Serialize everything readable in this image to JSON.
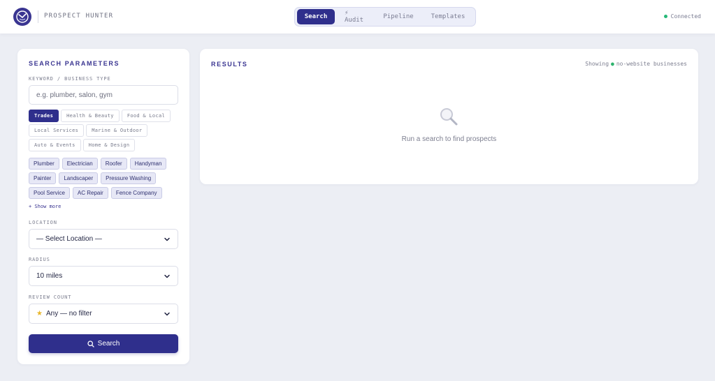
{
  "header": {
    "brand": "PROSPECT HUNTER",
    "tabs": [
      {
        "label": "Search",
        "active": true
      },
      {
        "label": "⚡ Audit",
        "active": false
      },
      {
        "label": "Pipeline",
        "active": false
      },
      {
        "label": "Templates",
        "active": false
      }
    ],
    "status": "Connected",
    "status_color": "#25b877"
  },
  "search": {
    "title": "SEARCH PARAMETERS",
    "keyword_label": "KEYWORD / BUSINESS TYPE",
    "keyword_placeholder": "e.g. plumber, salon, gym",
    "categories": [
      {
        "label": "Trades",
        "active": true
      },
      {
        "label": "Health & Beauty",
        "active": false
      },
      {
        "label": "Food & Local",
        "active": false
      },
      {
        "label": "Local Services",
        "active": false
      },
      {
        "label": "Marine & Outdoor",
        "active": false
      },
      {
        "label": "Auto & Events",
        "active": false
      },
      {
        "label": "Home & Design",
        "active": false
      }
    ],
    "subcategories": [
      "Plumber",
      "Electrician",
      "Roofer",
      "Handyman",
      "Painter",
      "Landscaper",
      "Pressure Washing",
      "Pool Service",
      "AC Repair",
      "Fence Company"
    ],
    "show_more": "+ Show more",
    "location_label": "LOCATION",
    "location_value": "— Select Location —",
    "radius_label": "RADIUS",
    "radius_value": "10 miles",
    "review_label": "REVIEW COUNT",
    "review_value": "Any — no filter",
    "button_label": "Search"
  },
  "results": {
    "title": "RESULTS",
    "showing_prefix": "Showing",
    "showing_suffix": "no-website businesses",
    "empty_text": "Run a search to find prospects"
  },
  "colors": {
    "accent": "#2f2f8c",
    "background": "#eceef4"
  }
}
